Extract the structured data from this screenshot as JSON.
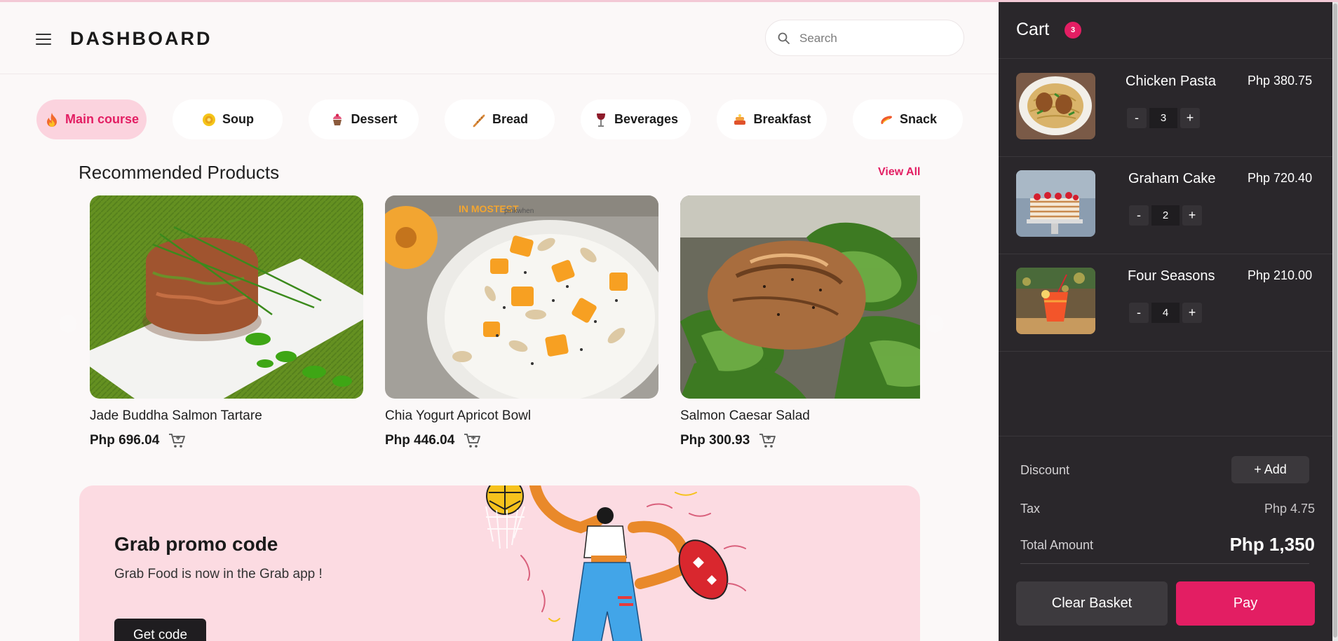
{
  "header": {
    "menu_icon": "hamburger-icon",
    "title": "DASHBOARD",
    "search_placeholder": "Search",
    "search_icon": "search-icon"
  },
  "categories": [
    {
      "label": "Main course",
      "icon": "flame-icon",
      "active": true
    },
    {
      "label": "Soup",
      "icon": "soup-icon",
      "active": false
    },
    {
      "label": "Dessert",
      "icon": "cupcake-icon",
      "active": false
    },
    {
      "label": "Bread",
      "icon": "bread-icon",
      "active": false
    },
    {
      "label": "Beverages",
      "icon": "wine-glass-icon",
      "active": false
    },
    {
      "label": "Breakfast",
      "icon": "breakfast-icon",
      "active": false
    },
    {
      "label": "Snack",
      "icon": "snack-icon",
      "active": false
    }
  ],
  "recommended": {
    "title": "Recommended Products",
    "view_all": "View All",
    "products": [
      {
        "name": "Jade Buddha Salmon Tartare",
        "price": "Php 696.04"
      },
      {
        "name": "Chia Yogurt Apricot Bowl",
        "price": "Php 446.04"
      },
      {
        "name": "Salmon Caesar Salad",
        "price": "Php 300.93"
      }
    ]
  },
  "promo": {
    "title": "Grab promo code",
    "subtitle": "Grab Food is now in the Grab app !",
    "button": "Get code"
  },
  "cart": {
    "title": "Cart",
    "count": "3",
    "items": [
      {
        "name": "Chicken Pasta",
        "price": "Php 380.75",
        "qty": "3"
      },
      {
        "name": "Graham Cake",
        "price": "Php 720.40",
        "qty": "2"
      },
      {
        "name": "Four Seasons",
        "price": "Php 210.00",
        "qty": "4"
      }
    ],
    "minus": "-",
    "plus": "+",
    "discount_label": "Discount",
    "add_label": "+ Add",
    "tax_label": "Tax",
    "tax_value": "Php 4.75",
    "total_label": "Total Amount",
    "total_value": "Php 1,350",
    "clear_label": "Clear Basket",
    "pay_label": "Pay"
  },
  "colors": {
    "accent": "#e31e63",
    "cart_bg": "#2a272b",
    "main_bg": "#fbf8f8",
    "promo_bg": "#fcdbe2",
    "active_chip_bg": "#fbd3de"
  }
}
